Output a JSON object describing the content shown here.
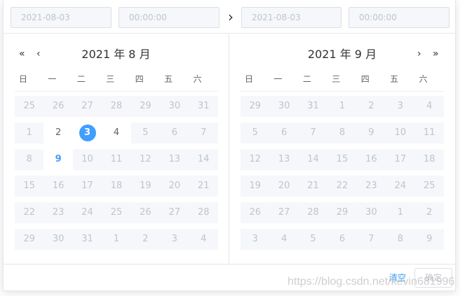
{
  "time_header": {
    "start_date_placeholder": "2021-08-03",
    "start_time_placeholder": "00:00:00",
    "separator": "›",
    "end_date_placeholder": "2021-08-03",
    "end_time_placeholder": "00:00:00"
  },
  "weekdays": [
    "日",
    "一",
    "二",
    "三",
    "四",
    "五",
    "六"
  ],
  "left": {
    "title": "2021 年 8 月",
    "prev_year": "«",
    "prev_month": "‹",
    "days": [
      {
        "d": "25",
        "s": "other"
      },
      {
        "d": "26",
        "s": "other"
      },
      {
        "d": "27",
        "s": "other"
      },
      {
        "d": "28",
        "s": "other"
      },
      {
        "d": "29",
        "s": "other"
      },
      {
        "d": "30",
        "s": "other"
      },
      {
        "d": "31",
        "s": "other"
      },
      {
        "d": "1",
        "s": "disabled"
      },
      {
        "d": "2",
        "s": "active"
      },
      {
        "d": "3",
        "s": "selected"
      },
      {
        "d": "4",
        "s": "active"
      },
      {
        "d": "5",
        "s": "disabled"
      },
      {
        "d": "6",
        "s": "disabled"
      },
      {
        "d": "7",
        "s": "disabled"
      },
      {
        "d": "8",
        "s": "disabled"
      },
      {
        "d": "9",
        "s": "today"
      },
      {
        "d": "10",
        "s": "disabled"
      },
      {
        "d": "11",
        "s": "disabled"
      },
      {
        "d": "12",
        "s": "disabled"
      },
      {
        "d": "13",
        "s": "disabled"
      },
      {
        "d": "14",
        "s": "disabled"
      },
      {
        "d": "15",
        "s": "disabled"
      },
      {
        "d": "16",
        "s": "disabled"
      },
      {
        "d": "17",
        "s": "disabled"
      },
      {
        "d": "18",
        "s": "disabled"
      },
      {
        "d": "19",
        "s": "disabled"
      },
      {
        "d": "20",
        "s": "disabled"
      },
      {
        "d": "21",
        "s": "disabled"
      },
      {
        "d": "22",
        "s": "disabled"
      },
      {
        "d": "23",
        "s": "disabled"
      },
      {
        "d": "24",
        "s": "disabled"
      },
      {
        "d": "25",
        "s": "disabled"
      },
      {
        "d": "26",
        "s": "disabled"
      },
      {
        "d": "27",
        "s": "disabled"
      },
      {
        "d": "28",
        "s": "disabled"
      },
      {
        "d": "29",
        "s": "disabled"
      },
      {
        "d": "30",
        "s": "disabled"
      },
      {
        "d": "31",
        "s": "disabled"
      },
      {
        "d": "1",
        "s": "other"
      },
      {
        "d": "2",
        "s": "other"
      },
      {
        "d": "3",
        "s": "other"
      },
      {
        "d": "4",
        "s": "other"
      }
    ]
  },
  "right": {
    "title": "2021 年 9 月",
    "next_month": "›",
    "next_year": "»",
    "days": [
      {
        "d": "29",
        "s": "other"
      },
      {
        "d": "30",
        "s": "other"
      },
      {
        "d": "31",
        "s": "other"
      },
      {
        "d": "1",
        "s": "disabled"
      },
      {
        "d": "2",
        "s": "disabled"
      },
      {
        "d": "3",
        "s": "disabled"
      },
      {
        "d": "4",
        "s": "disabled"
      },
      {
        "d": "5",
        "s": "disabled"
      },
      {
        "d": "6",
        "s": "disabled"
      },
      {
        "d": "7",
        "s": "disabled"
      },
      {
        "d": "8",
        "s": "disabled"
      },
      {
        "d": "9",
        "s": "disabled"
      },
      {
        "d": "10",
        "s": "disabled"
      },
      {
        "d": "11",
        "s": "disabled"
      },
      {
        "d": "12",
        "s": "disabled"
      },
      {
        "d": "13",
        "s": "disabled"
      },
      {
        "d": "14",
        "s": "disabled"
      },
      {
        "d": "15",
        "s": "disabled"
      },
      {
        "d": "16",
        "s": "disabled"
      },
      {
        "d": "17",
        "s": "disabled"
      },
      {
        "d": "18",
        "s": "disabled"
      },
      {
        "d": "19",
        "s": "disabled"
      },
      {
        "d": "20",
        "s": "disabled"
      },
      {
        "d": "21",
        "s": "disabled"
      },
      {
        "d": "22",
        "s": "disabled"
      },
      {
        "d": "23",
        "s": "disabled"
      },
      {
        "d": "24",
        "s": "disabled"
      },
      {
        "d": "25",
        "s": "disabled"
      },
      {
        "d": "26",
        "s": "disabled"
      },
      {
        "d": "27",
        "s": "disabled"
      },
      {
        "d": "28",
        "s": "disabled"
      },
      {
        "d": "29",
        "s": "disabled"
      },
      {
        "d": "30",
        "s": "disabled"
      },
      {
        "d": "1",
        "s": "other"
      },
      {
        "d": "2",
        "s": "other"
      },
      {
        "d": "3",
        "s": "other"
      },
      {
        "d": "4",
        "s": "other"
      },
      {
        "d": "5",
        "s": "other"
      },
      {
        "d": "6",
        "s": "other"
      },
      {
        "d": "7",
        "s": "other"
      },
      {
        "d": "8",
        "s": "other"
      },
      {
        "d": "9",
        "s": "other"
      }
    ]
  },
  "footer": {
    "clear_label": "清空",
    "ok_label": "确定"
  },
  "watermark": "https://blog.csdn.net/kevin681996",
  "colors": {
    "accent": "#409eff",
    "disabled_bg": "#f5f7fa",
    "disabled_text": "#c0c4cc"
  }
}
